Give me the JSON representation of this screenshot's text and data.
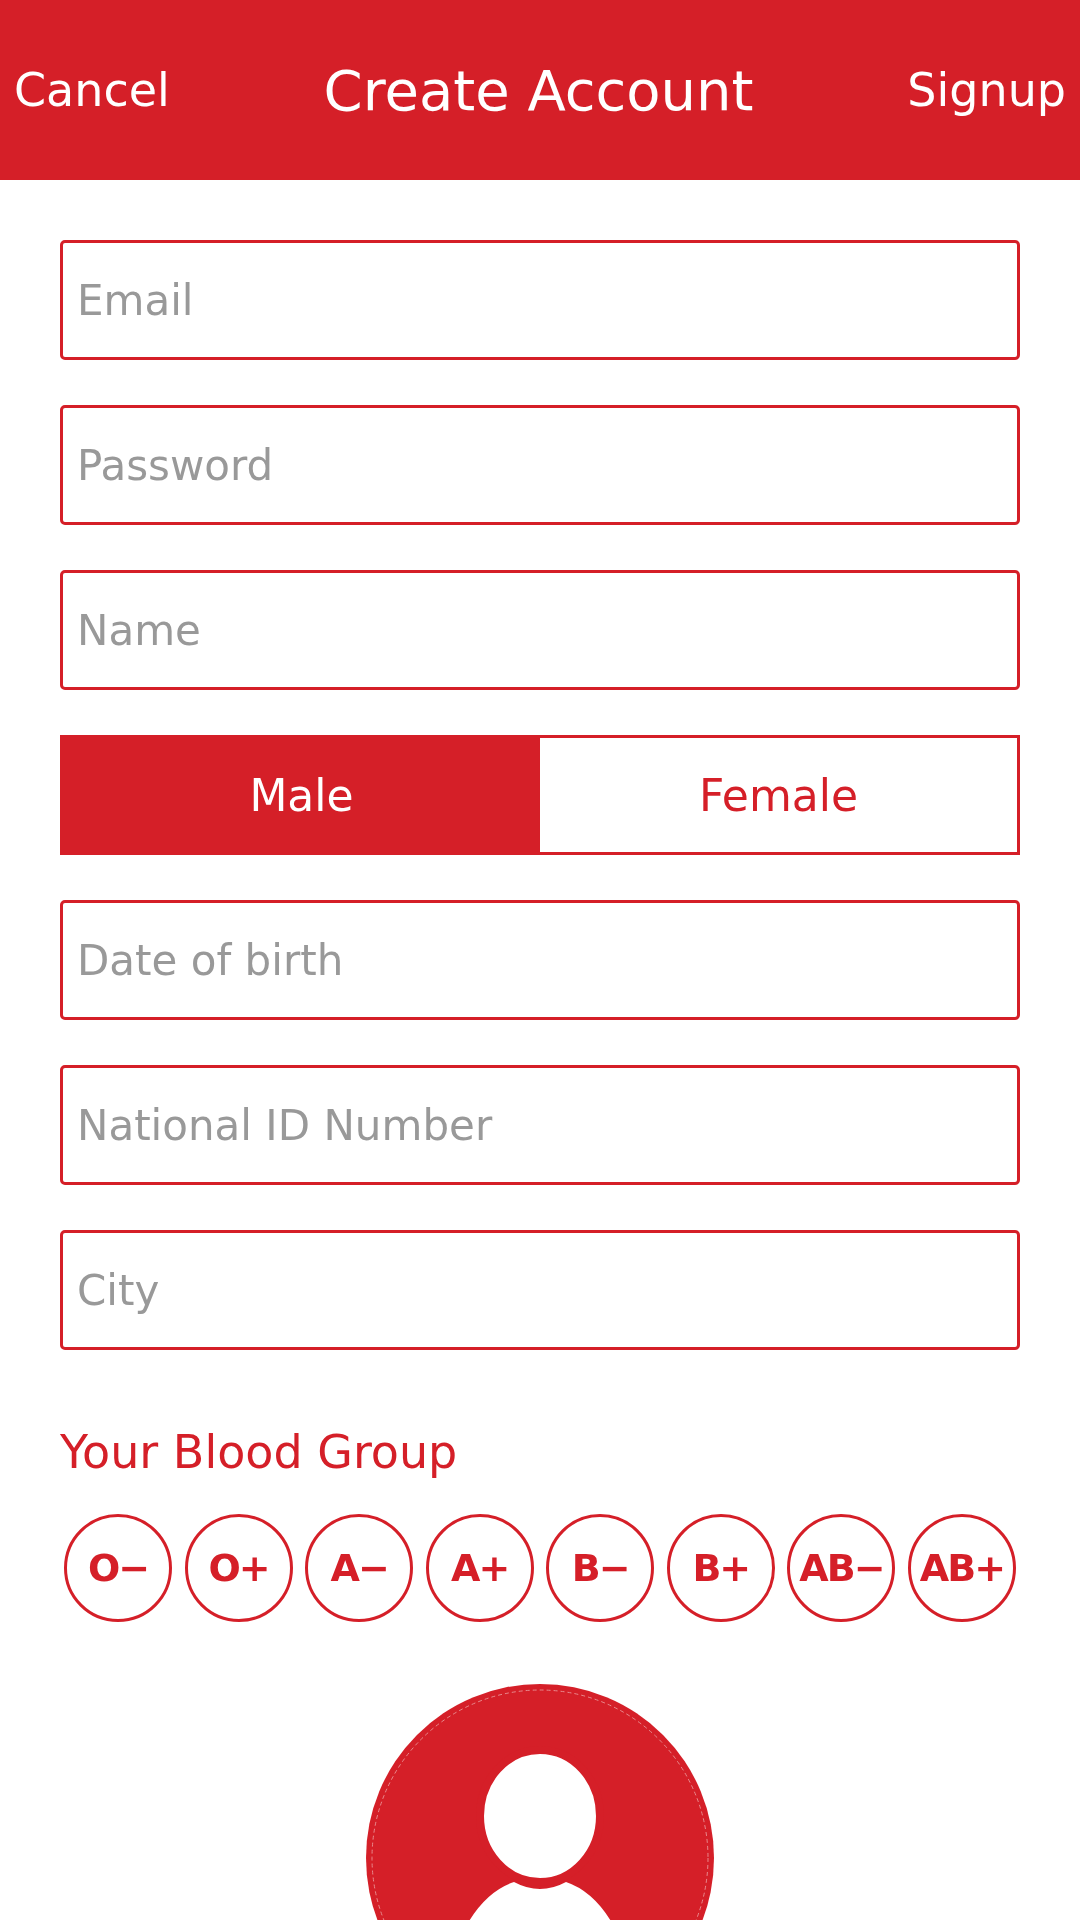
{
  "header": {
    "cancel": "Cancel",
    "title": "Create Account",
    "signup": "Signup"
  },
  "fields": [
    {
      "placeholder": "Email"
    },
    {
      "placeholder": "Password"
    },
    {
      "placeholder": "Name"
    }
  ],
  "gender": [
    {
      "label": "Male",
      "selected": true
    },
    {
      "label": "Female",
      "selected": false
    }
  ],
  "more_fields": [
    {
      "placeholder": "Date of birth"
    },
    {
      "placeholder": "National ID Number"
    },
    {
      "placeholder": "City"
    }
  ],
  "blood_group": {
    "label": "Your Blood Group",
    "options": [
      {
        "label": "O−",
        "selected": false
      },
      {
        "label": "O+",
        "selected": false
      },
      {
        "label": "A−",
        "selected": false
      },
      {
        "label": "A+",
        "selected": false
      },
      {
        "label": "B−",
        "selected": false
      },
      {
        "label": "B+",
        "selected": false
      },
      {
        "label": "AB−",
        "selected": false
      },
      {
        "label": "AB+",
        "selected": false
      }
    ]
  }
}
